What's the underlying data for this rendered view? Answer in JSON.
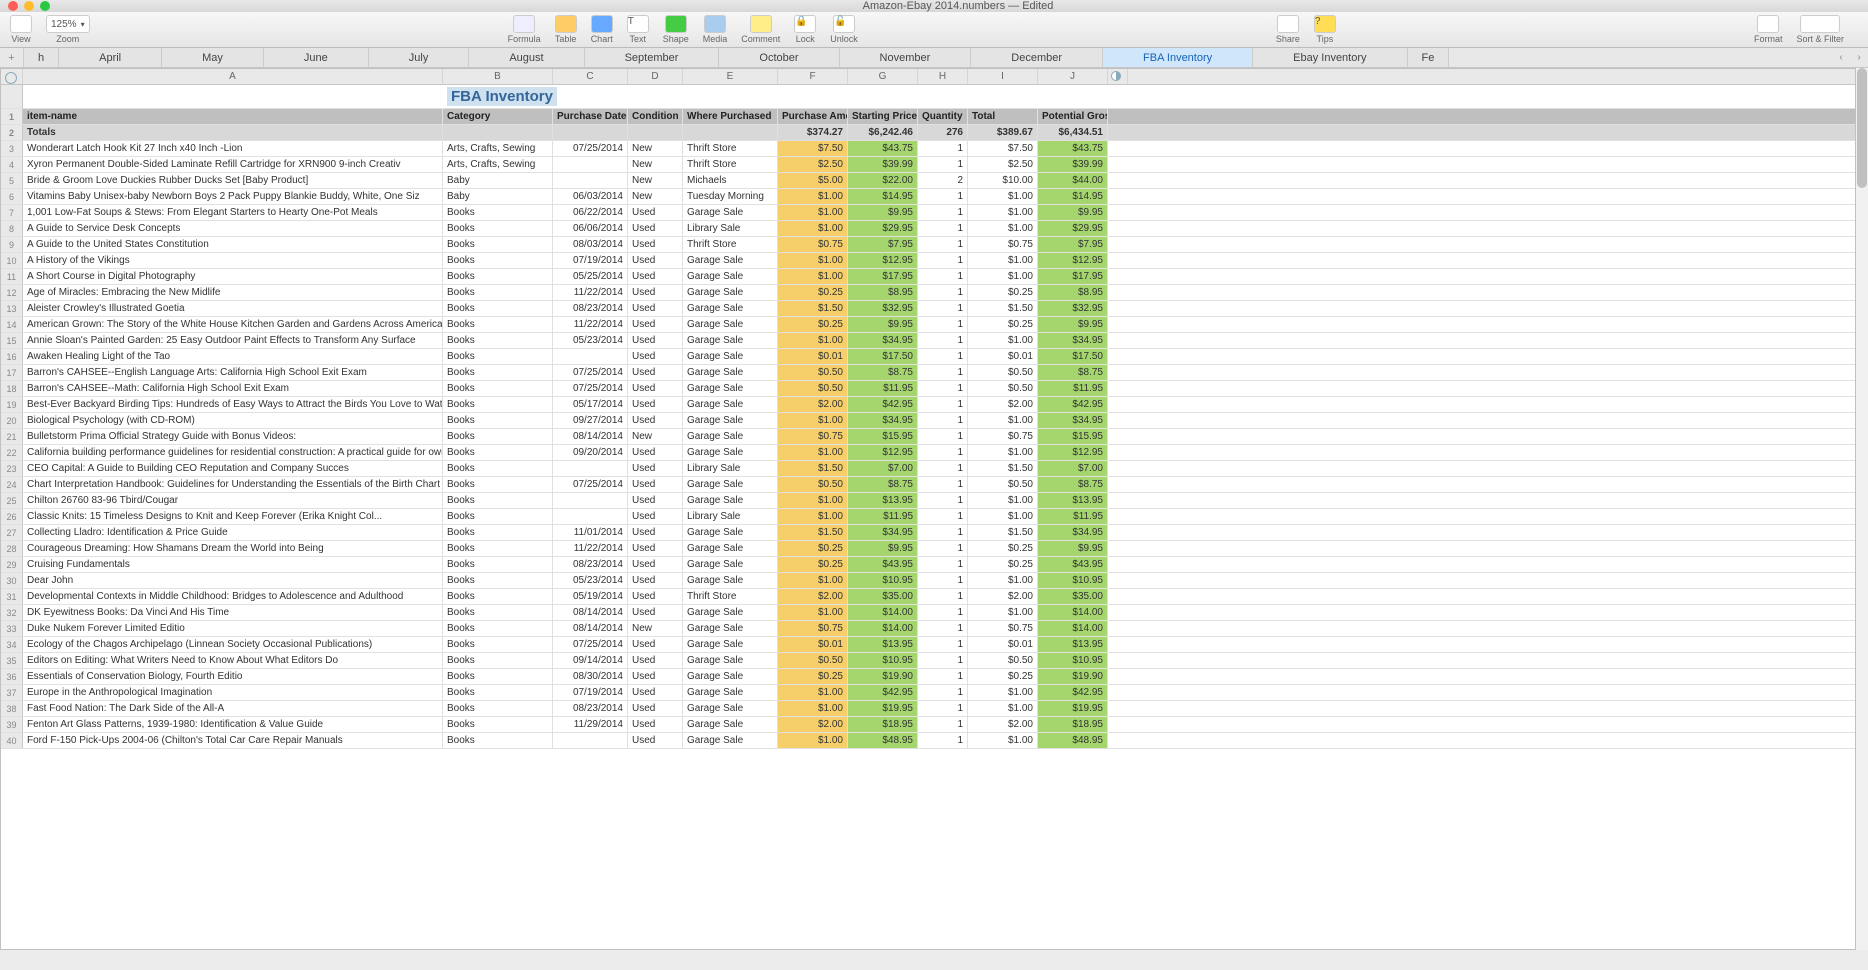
{
  "window": {
    "title": "Amazon-Ebay 2014.numbers — Edited"
  },
  "toolbar": {
    "view": "View",
    "zoom": "Zoom",
    "zoom_value": "125%",
    "formula": "Formula",
    "table": "Table",
    "chart": "Chart",
    "text": "Text",
    "shape": "Shape",
    "media": "Media",
    "comment": "Comment",
    "lock": "Lock",
    "unlock": "Unlock",
    "share": "Share",
    "tips": "Tips",
    "format": "Format",
    "sortfilter": "Sort & Filter"
  },
  "tabs": {
    "items": [
      "h",
      "April",
      "May",
      "June",
      "July",
      "August",
      "September",
      "October",
      "November",
      "December",
      "FBA Inventory",
      "Ebay Inventory",
      "Fe"
    ],
    "active": "FBA Inventory"
  },
  "columns_letters": [
    "A",
    "B",
    "C",
    "D",
    "E",
    "F",
    "G",
    "H",
    "I",
    "J"
  ],
  "sheet_title": "FBA Inventory",
  "headers": {
    "item": "item-name",
    "category": "Category",
    "purchase_date": "Purchase Date",
    "condition": "Condition",
    "where": "Where Purchased",
    "amount": "Purchase Amount",
    "starting": "Starting Price",
    "qty": "Quantity",
    "total": "Total",
    "gross": "Potential Gross"
  },
  "totals": {
    "label": "Totals",
    "amount": "$374.27",
    "starting": "$6,242.46",
    "qty": "276",
    "total": "$389.67",
    "gross": "$6,434.51"
  },
  "rows": [
    {
      "n": 3,
      "item": "Wonderart Latch Hook Kit 27 Inch x40 Inch -Lion",
      "cat": "Arts, Crafts, Sewing",
      "date": "07/25/2014",
      "cond": "New",
      "where": "Thrift Store",
      "amt": "$7.50",
      "start": "$43.75",
      "qty": "1",
      "tot": "$7.50",
      "gross": "$43.75"
    },
    {
      "n": 4,
      "item": "Xyron Permanent Double-Sided Laminate Refill Cartridge for XRN900 9-inch Creativ",
      "cat": "Arts, Crafts, Sewing",
      "date": "",
      "cond": "New",
      "where": "Thrift Store",
      "amt": "$2.50",
      "start": "$39.99",
      "qty": "1",
      "tot": "$2.50",
      "gross": "$39.99"
    },
    {
      "n": 5,
      "item": "Bride & Groom Love Duckies Rubber Ducks Set [Baby Product]",
      "cat": "Baby",
      "date": "",
      "cond": "New",
      "where": "Michaels",
      "amt": "$5.00",
      "start": "$22.00",
      "qty": "2",
      "tot": "$10.00",
      "gross": "$44.00"
    },
    {
      "n": 6,
      "item": "Vitamins Baby Unisex-baby Newborn Boys 2 Pack Puppy Blankie Buddy, White, One Siz",
      "cat": "Baby",
      "date": "06/03/2014",
      "cond": "New",
      "where": "Tuesday Morning",
      "amt": "$1.00",
      "start": "$14.95",
      "qty": "1",
      "tot": "$1.00",
      "gross": "$14.95"
    },
    {
      "n": 7,
      "item": "1,001 Low-Fat Soups & Stews: From Elegant Starters to Hearty One-Pot Meals",
      "cat": "Books",
      "date": "06/22/2014",
      "cond": "Used",
      "where": "Garage Sale",
      "amt": "$1.00",
      "start": "$9.95",
      "qty": "1",
      "tot": "$1.00",
      "gross": "$9.95"
    },
    {
      "n": 8,
      "item": "A Guide to Service Desk Concepts",
      "cat": "Books",
      "date": "06/06/2014",
      "cond": "Used",
      "where": "Library Sale",
      "amt": "$1.00",
      "start": "$29.95",
      "qty": "1",
      "tot": "$1.00",
      "gross": "$29.95"
    },
    {
      "n": 9,
      "item": "A Guide to the United States Constitution",
      "cat": "Books",
      "date": "08/03/2014",
      "cond": "Used",
      "where": "Thrift Store",
      "amt": "$0.75",
      "start": "$7.95",
      "qty": "1",
      "tot": "$0.75",
      "gross": "$7.95"
    },
    {
      "n": 10,
      "item": "A History of the Vikings",
      "cat": "Books",
      "date": "07/19/2014",
      "cond": "Used",
      "where": "Garage Sale",
      "amt": "$1.00",
      "start": "$12.95",
      "qty": "1",
      "tot": "$1.00",
      "gross": "$12.95"
    },
    {
      "n": 11,
      "item": "A Short Course in Digital Photography",
      "cat": "Books",
      "date": "05/25/2014",
      "cond": "Used",
      "where": "Garage Sale",
      "amt": "$1.00",
      "start": "$17.95",
      "qty": "1",
      "tot": "$1.00",
      "gross": "$17.95"
    },
    {
      "n": 12,
      "item": "Age of Miracles: Embracing the New Midlife",
      "cat": "Books",
      "date": "11/22/2014",
      "cond": "Used",
      "where": "Garage Sale",
      "amt": "$0.25",
      "start": "$8.95",
      "qty": "1",
      "tot": "$0.25",
      "gross": "$8.95"
    },
    {
      "n": 13,
      "item": "Aleister Crowley's Illustrated Goetia",
      "cat": "Books",
      "date": "08/23/2014",
      "cond": "Used",
      "where": "Garage Sale",
      "amt": "$1.50",
      "start": "$32.95",
      "qty": "1",
      "tot": "$1.50",
      "gross": "$32.95"
    },
    {
      "n": 14,
      "item": "American Grown: The Story of the White House Kitchen Garden and Gardens Across America",
      "cat": "Books",
      "date": "11/22/2014",
      "cond": "Used",
      "where": "Garage Sale",
      "amt": "$0.25",
      "start": "$9.95",
      "qty": "1",
      "tot": "$0.25",
      "gross": "$9.95"
    },
    {
      "n": 15,
      "item": "Annie Sloan's Painted Garden: 25 Easy Outdoor Paint Effects to Transform Any Surface",
      "cat": "Books",
      "date": "05/23/2014",
      "cond": "Used",
      "where": "Garage Sale",
      "amt": "$1.00",
      "start": "$34.95",
      "qty": "1",
      "tot": "$1.00",
      "gross": "$34.95"
    },
    {
      "n": 16,
      "item": "Awaken Healing Light of the Tao",
      "cat": "Books",
      "date": "",
      "cond": "Used",
      "where": "Garage Sale",
      "amt": "$0.01",
      "start": "$17.50",
      "qty": "1",
      "tot": "$0.01",
      "gross": "$17.50"
    },
    {
      "n": 17,
      "item": "Barron's CAHSEE--English Language Arts: California High School Exit Exam",
      "cat": "Books",
      "date": "07/25/2014",
      "cond": "Used",
      "where": "Garage Sale",
      "amt": "$0.50",
      "start": "$8.75",
      "qty": "1",
      "tot": "$0.50",
      "gross": "$8.75"
    },
    {
      "n": 18,
      "item": "Barron's CAHSEE--Math: California High School Exit Exam",
      "cat": "Books",
      "date": "07/25/2014",
      "cond": "Used",
      "where": "Garage Sale",
      "amt": "$0.50",
      "start": "$11.95",
      "qty": "1",
      "tot": "$0.50",
      "gross": "$11.95"
    },
    {
      "n": 19,
      "item": "Best-Ever Backyard Birding Tips: Hundreds of Easy Ways to Attract the Birds You Love to Watch",
      "cat": "Books",
      "date": "05/17/2014",
      "cond": "Used",
      "where": "Garage Sale",
      "amt": "$2.00",
      "start": "$42.95",
      "qty": "1",
      "tot": "$2.00",
      "gross": "$42.95"
    },
    {
      "n": 20,
      "item": "Biological Psychology (with CD-ROM)",
      "cat": "Books",
      "date": "09/27/2014",
      "cond": "Used",
      "where": "Garage Sale",
      "amt": "$1.00",
      "start": "$34.95",
      "qty": "1",
      "tot": "$1.00",
      "gross": "$34.95"
    },
    {
      "n": 21,
      "item": "Bulletstorm Prima Official Strategy Guide with Bonus Videos:",
      "cat": "Books",
      "date": "08/14/2014",
      "cond": "New",
      "where": "Garage Sale",
      "amt": "$0.75",
      "start": "$15.95",
      "qty": "1",
      "tot": "$0.75",
      "gross": "$15.95"
    },
    {
      "n": 22,
      "item": "California building performance guidelines for residential construction: A practical guide for owners of new homes : constr",
      "cat": "Books",
      "date": "09/20/2014",
      "cond": "Used",
      "where": "Garage Sale",
      "amt": "$1.00",
      "start": "$12.95",
      "qty": "1",
      "tot": "$1.00",
      "gross": "$12.95"
    },
    {
      "n": 23,
      "item": "CEO Capital: A Guide to Building CEO Reputation and Company Succes",
      "cat": "Books",
      "date": "",
      "cond": "Used",
      "where": "Library Sale",
      "amt": "$1.50",
      "start": "$7.00",
      "qty": "1",
      "tot": "$1.50",
      "gross": "$7.00"
    },
    {
      "n": 24,
      "item": "Chart Interpretation Handbook: Guidelines for Understanding the Essentials of the Birth Chart",
      "cat": "Books",
      "date": "07/25/2014",
      "cond": "Used",
      "where": "Garage Sale",
      "amt": "$0.50",
      "start": "$8.75",
      "qty": "1",
      "tot": "$0.50",
      "gross": "$8.75"
    },
    {
      "n": 25,
      "item": "Chilton 26760 83-96 Tbird/Cougar",
      "cat": "Books",
      "date": "",
      "cond": "Used",
      "where": "Garage Sale",
      "amt": "$1.00",
      "start": "$13.95",
      "qty": "1",
      "tot": "$1.00",
      "gross": "$13.95"
    },
    {
      "n": 26,
      "item": "Classic Knits: 15 Timeless Designs to Knit and Keep Forever (Erika Knight Col...",
      "cat": "Books",
      "date": "",
      "cond": "Used",
      "where": "Library Sale",
      "amt": "$1.00",
      "start": "$11.95",
      "qty": "1",
      "tot": "$1.00",
      "gross": "$11.95"
    },
    {
      "n": 27,
      "item": "Collecting Lladro: Identification & Price Guide",
      "cat": "Books",
      "date": "11/01/2014",
      "cond": "Used",
      "where": "Garage Sale",
      "amt": "$1.50",
      "start": "$34.95",
      "qty": "1",
      "tot": "$1.50",
      "gross": "$34.95"
    },
    {
      "n": 28,
      "item": "Courageous Dreaming: How Shamans Dream the World into Being",
      "cat": "Books",
      "date": "11/22/2014",
      "cond": "Used",
      "where": "Garage Sale",
      "amt": "$0.25",
      "start": "$9.95",
      "qty": "1",
      "tot": "$0.25",
      "gross": "$9.95"
    },
    {
      "n": 29,
      "item": "Cruising Fundamentals",
      "cat": "Books",
      "date": "08/23/2014",
      "cond": "Used",
      "where": "Garage Sale",
      "amt": "$0.25",
      "start": "$43.95",
      "qty": "1",
      "tot": "$0.25",
      "gross": "$43.95"
    },
    {
      "n": 30,
      "item": "Dear John",
      "cat": "Books",
      "date": "05/23/2014",
      "cond": "Used",
      "where": "Garage Sale",
      "amt": "$1.00",
      "start": "$10.95",
      "qty": "1",
      "tot": "$1.00",
      "gross": "$10.95"
    },
    {
      "n": 31,
      "item": "Developmental Contexts in Middle Childhood: Bridges to Adolescence and Adulthood",
      "cat": "Books",
      "date": "05/19/2014",
      "cond": "Used",
      "where": "Thrift Store",
      "amt": "$2.00",
      "start": "$35.00",
      "qty": "1",
      "tot": "$2.00",
      "gross": "$35.00"
    },
    {
      "n": 32,
      "item": "DK Eyewitness Books: Da Vinci And His Time",
      "cat": "Books",
      "date": "08/14/2014",
      "cond": "Used",
      "where": "Garage Sale",
      "amt": "$1.00",
      "start": "$14.00",
      "qty": "1",
      "tot": "$1.00",
      "gross": "$14.00"
    },
    {
      "n": 33,
      "item": "Duke Nukem Forever Limited Editio",
      "cat": "Books",
      "date": "08/14/2014",
      "cond": "New",
      "where": "Garage Sale",
      "amt": "$0.75",
      "start": "$14.00",
      "qty": "1",
      "tot": "$0.75",
      "gross": "$14.00"
    },
    {
      "n": 34,
      "item": "Ecology of the Chagos Archipelago (Linnean Society Occasional Publications)",
      "cat": "Books",
      "date": "07/25/2014",
      "cond": "Used",
      "where": "Garage Sale",
      "amt": "$0.01",
      "start": "$13.95",
      "qty": "1",
      "tot": "$0.01",
      "gross": "$13.95"
    },
    {
      "n": 35,
      "item": "Editors on Editing: What Writers Need to Know About What Editors Do",
      "cat": "Books",
      "date": "09/14/2014",
      "cond": "Used",
      "where": "Garage Sale",
      "amt": "$0.50",
      "start": "$10.95",
      "qty": "1",
      "tot": "$0.50",
      "gross": "$10.95"
    },
    {
      "n": 36,
      "item": "Essentials of Conservation Biology, Fourth Editio",
      "cat": "Books",
      "date": "08/30/2014",
      "cond": "Used",
      "where": "Garage Sale",
      "amt": "$0.25",
      "start": "$19.90",
      "qty": "1",
      "tot": "$0.25",
      "gross": "$19.90"
    },
    {
      "n": 37,
      "item": "Europe in the Anthropological Imagination",
      "cat": "Books",
      "date": "07/19/2014",
      "cond": "Used",
      "where": "Garage Sale",
      "amt": "$1.00",
      "start": "$42.95",
      "qty": "1",
      "tot": "$1.00",
      "gross": "$42.95"
    },
    {
      "n": 38,
      "item": "Fast Food Nation: The Dark Side of the All-A",
      "cat": "Books",
      "date": "08/23/2014",
      "cond": "Used",
      "where": "Garage Sale",
      "amt": "$1.00",
      "start": "$19.95",
      "qty": "1",
      "tot": "$1.00",
      "gross": "$19.95"
    },
    {
      "n": 39,
      "item": "Fenton Art Glass Patterns, 1939-1980: Identification & Value Guide",
      "cat": "Books",
      "date": "11/29/2014",
      "cond": "Used",
      "where": "Garage Sale",
      "amt": "$2.00",
      "start": "$18.95",
      "qty": "1",
      "tot": "$2.00",
      "gross": "$18.95"
    },
    {
      "n": 40,
      "item": "Ford F-150 Pick-Ups 2004-06 (Chilton's Total Car Care Repair Manuals",
      "cat": "Books",
      "date": "",
      "cond": "Used",
      "where": "Garage Sale",
      "amt": "$1.00",
      "start": "$48.95",
      "qty": "1",
      "tot": "$1.00",
      "gross": "$48.95"
    }
  ]
}
